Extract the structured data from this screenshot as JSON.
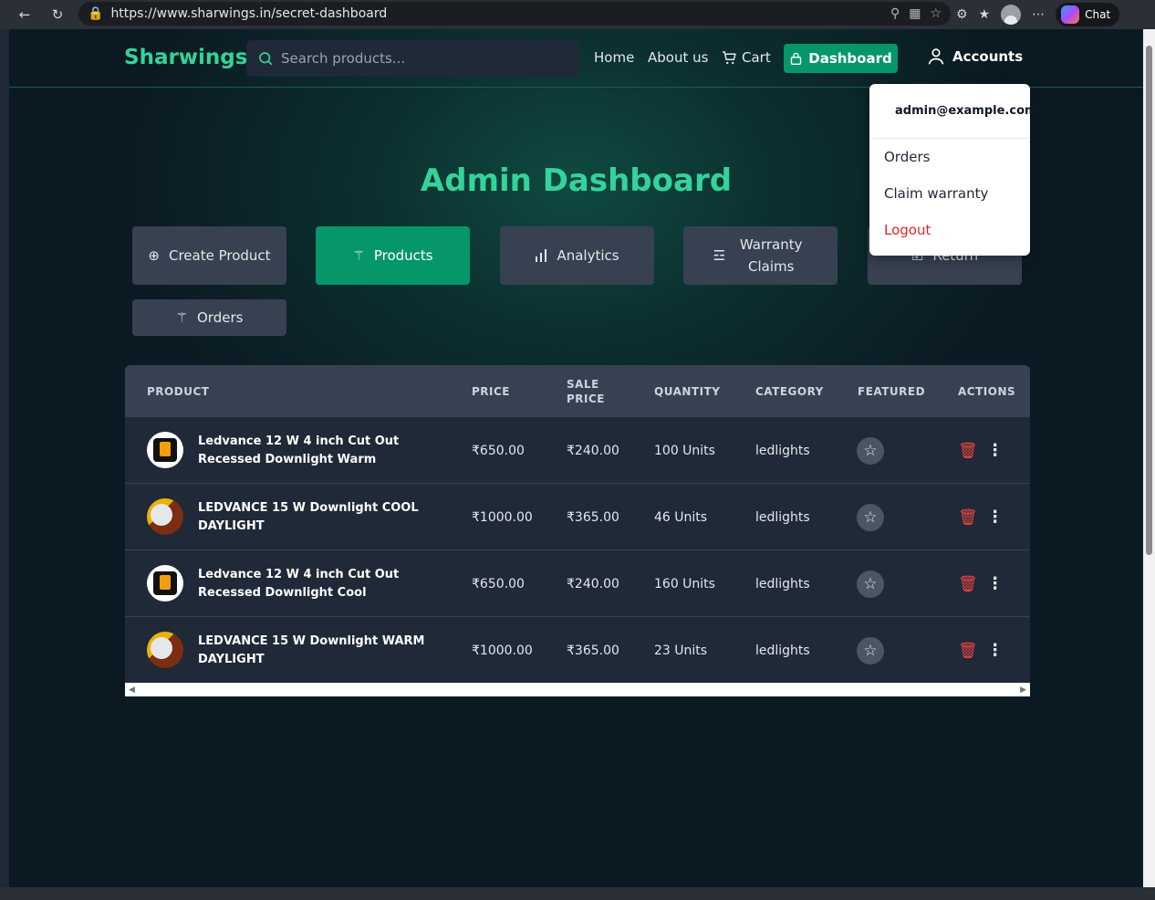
{
  "browser": {
    "url": "https://www.sharwings.in/secret-dashboard",
    "chat_label": "Chat"
  },
  "navbar": {
    "brand": "Sharwings",
    "search_placeholder": "Search products...",
    "links": {
      "home": "Home",
      "about": "About us",
      "cart": "Cart"
    },
    "dashboard_label": "Dashboard",
    "accounts_label": "Accounts"
  },
  "page": {
    "title": "Admin Dashboard"
  },
  "tabs": {
    "create_product": "Create Product",
    "products": "Products",
    "analytics": "Analytics",
    "warranty_claims": "Warranty Claims",
    "return": "Return",
    "orders": "Orders"
  },
  "table": {
    "headers": {
      "product": "PRODUCT",
      "price": "PRICE",
      "sale_price": "SALE PRICE",
      "quantity": "QUANTITY",
      "category": "CATEGORY",
      "featured": "FEATURED",
      "actions": "ACTIONS"
    },
    "rows": [
      {
        "name": "Ledvance 12 W 4 inch Cut Out Recessed Downlight Warm",
        "price": "₹650.00",
        "sale_price": "₹240.00",
        "quantity": "100 Units",
        "category": "ledlights"
      },
      {
        "name": "LEDVANCE 15 W Downlight COOL DAYLIGHT",
        "price": "₹1000.00",
        "sale_price": "₹365.00",
        "quantity": "46 Units",
        "category": "ledlights"
      },
      {
        "name": "Ledvance 12 W 4 inch Cut Out Recessed Downlight Cool",
        "price": "₹650.00",
        "sale_price": "₹240.00",
        "quantity": "160 Units",
        "category": "ledlights"
      },
      {
        "name": "LEDVANCE 15 W Downlight WARM DAYLIGHT",
        "price": "₹1000.00",
        "sale_price": "₹365.00",
        "quantity": "23 Units",
        "category": "ledlights"
      }
    ]
  },
  "dropdown": {
    "email": "admin@example.com",
    "orders": "Orders",
    "claim_warranty": "Claim warranty",
    "logout": "Logout"
  },
  "colors": {
    "accent": "#34d399",
    "primary_button": "#059669",
    "danger": "#dc2626"
  },
  "icons": [
    "back-icon",
    "refresh-icon",
    "lock-icon",
    "search-icon",
    "cart-icon",
    "user-icon",
    "plus-circle-icon",
    "basket-icon",
    "bar-chart-icon",
    "star-icon",
    "trash-icon",
    "more-vertical-icon"
  ]
}
